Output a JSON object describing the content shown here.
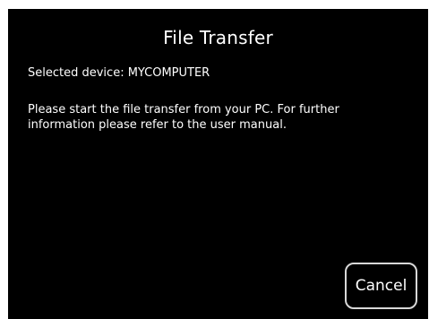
{
  "dialog": {
    "title": "File Transfer",
    "selected_device_text": "Selected device: MYCOMPUTER",
    "message": "Please start the file transfer from your PC. For further information please refer to the user manual.",
    "cancel_label": "Cancel"
  },
  "colors": {
    "background": "#000000",
    "text": "#ffffff",
    "button_border": "#d8d8d8"
  }
}
